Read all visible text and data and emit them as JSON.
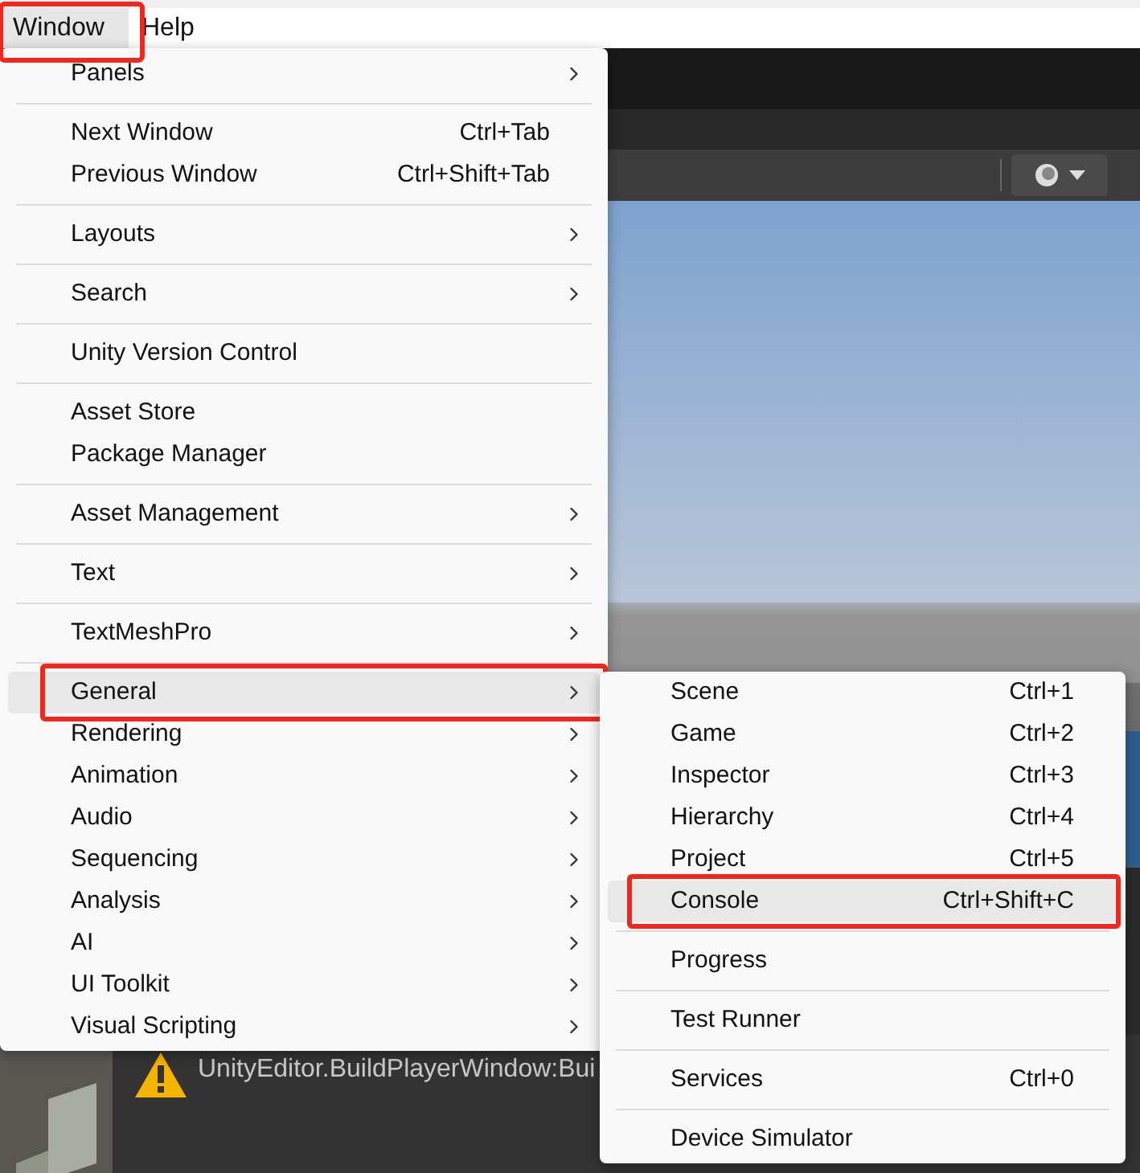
{
  "menubar": [
    {
      "label": "Window",
      "selected": true,
      "annotated": true
    },
    {
      "label": "Help",
      "selected": false,
      "annotated": false
    }
  ],
  "window_menu": [
    {
      "kind": "item",
      "label": "Panels",
      "has_submenu": true,
      "hovered": false,
      "annotated": false
    },
    {
      "kind": "separator"
    },
    {
      "kind": "item",
      "label": "Next Window",
      "shortcut": "Ctrl+Tab",
      "has_submenu": false,
      "hovered": false,
      "annotated": false
    },
    {
      "kind": "item",
      "label": "Previous Window",
      "shortcut": "Ctrl+Shift+Tab",
      "has_submenu": false,
      "hovered": false,
      "annotated": false
    },
    {
      "kind": "separator"
    },
    {
      "kind": "item",
      "label": "Layouts",
      "has_submenu": true,
      "hovered": false,
      "annotated": false
    },
    {
      "kind": "separator"
    },
    {
      "kind": "item",
      "label": "Search",
      "has_submenu": true,
      "hovered": false,
      "annotated": false
    },
    {
      "kind": "separator"
    },
    {
      "kind": "item",
      "label": "Unity Version Control",
      "has_submenu": false,
      "hovered": false,
      "annotated": false
    },
    {
      "kind": "separator"
    },
    {
      "kind": "item",
      "label": "Asset Store",
      "has_submenu": false,
      "hovered": false,
      "annotated": false
    },
    {
      "kind": "item",
      "label": "Package Manager",
      "has_submenu": false,
      "hovered": false,
      "annotated": false
    },
    {
      "kind": "separator"
    },
    {
      "kind": "item",
      "label": "Asset Management",
      "has_submenu": true,
      "hovered": false,
      "annotated": false
    },
    {
      "kind": "separator"
    },
    {
      "kind": "item",
      "label": "Text",
      "has_submenu": true,
      "hovered": false,
      "annotated": false
    },
    {
      "kind": "separator"
    },
    {
      "kind": "item",
      "label": "TextMeshPro",
      "has_submenu": true,
      "hovered": false,
      "annotated": false
    },
    {
      "kind": "separator"
    },
    {
      "kind": "item",
      "label": "General",
      "has_submenu": true,
      "hovered": true,
      "annotated": true
    },
    {
      "kind": "item",
      "label": "Rendering",
      "has_submenu": true,
      "hovered": false,
      "annotated": false
    },
    {
      "kind": "item",
      "label": "Animation",
      "has_submenu": true,
      "hovered": false,
      "annotated": false
    },
    {
      "kind": "item",
      "label": "Audio",
      "has_submenu": true,
      "hovered": false,
      "annotated": false
    },
    {
      "kind": "item",
      "label": "Sequencing",
      "has_submenu": true,
      "hovered": false,
      "annotated": false
    },
    {
      "kind": "item",
      "label": "Analysis",
      "has_submenu": true,
      "hovered": false,
      "annotated": false
    },
    {
      "kind": "item",
      "label": "AI",
      "has_submenu": true,
      "hovered": false,
      "annotated": false
    },
    {
      "kind": "item",
      "label": "UI Toolkit",
      "has_submenu": true,
      "hovered": false,
      "annotated": false
    },
    {
      "kind": "item",
      "label": "Visual Scripting",
      "has_submenu": true,
      "hovered": false,
      "annotated": false
    }
  ],
  "general_submenu": [
    {
      "kind": "item",
      "label": "Scene",
      "shortcut": "Ctrl+1",
      "hovered": false,
      "annotated": false
    },
    {
      "kind": "item",
      "label": "Game",
      "shortcut": "Ctrl+2",
      "hovered": false,
      "annotated": false
    },
    {
      "kind": "item",
      "label": "Inspector",
      "shortcut": "Ctrl+3",
      "hovered": false,
      "annotated": false
    },
    {
      "kind": "item",
      "label": "Hierarchy",
      "shortcut": "Ctrl+4",
      "hovered": false,
      "annotated": false
    },
    {
      "kind": "item",
      "label": "Project",
      "shortcut": "Ctrl+5",
      "hovered": false,
      "annotated": false
    },
    {
      "kind": "item",
      "label": "Console",
      "shortcut": "Ctrl+Shift+C",
      "hovered": true,
      "annotated": true
    },
    {
      "kind": "separator"
    },
    {
      "kind": "item",
      "label": "Progress",
      "hovered": false,
      "annotated": false
    },
    {
      "kind": "separator"
    },
    {
      "kind": "item",
      "label": "Test Runner",
      "hovered": false,
      "annotated": false
    },
    {
      "kind": "separator"
    },
    {
      "kind": "item",
      "label": "Services",
      "shortcut": "Ctrl+0",
      "hovered": false,
      "annotated": false
    },
    {
      "kind": "separator"
    },
    {
      "kind": "item",
      "label": "Device Simulator",
      "hovered": false,
      "annotated": false
    }
  ],
  "console": {
    "message": "UnityEditor.BuildPlayerWindow:Bui"
  }
}
